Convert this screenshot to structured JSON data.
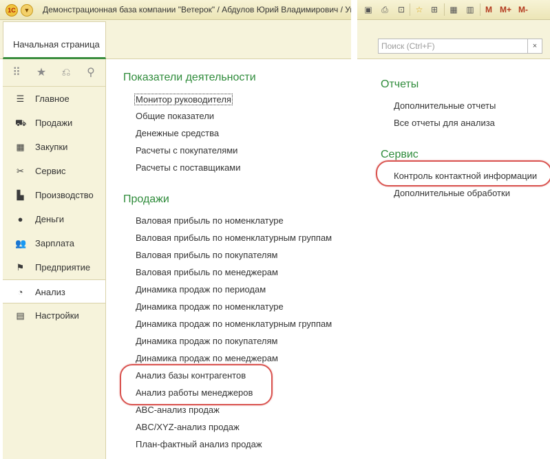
{
  "window": {
    "title": "Демонстрационная база компании \"Ветерок\" / Абдулов Юрий Владимирович / Управл",
    "logo_text": "1С",
    "menu_icon": "chevron-down-icon"
  },
  "home_tab": {
    "label": "Начальная страница"
  },
  "sidebar": {
    "tools": [
      "apps-grid-icon",
      "star-icon",
      "history-icon",
      "search-icon"
    ],
    "items": [
      {
        "label": "Главное",
        "icon": "menu-lines-icon"
      },
      {
        "label": "Продажи",
        "icon": "basket-icon"
      },
      {
        "label": "Закупки",
        "icon": "cart-icon"
      },
      {
        "label": "Сервис",
        "icon": "tools-icon"
      },
      {
        "label": "Производство",
        "icon": "factory-icon"
      },
      {
        "label": "Деньги",
        "icon": "ruble-coin-icon"
      },
      {
        "label": "Зарплата",
        "icon": "people-icon"
      },
      {
        "label": "Предприятие",
        "icon": "flag-icon"
      },
      {
        "label": "Анализ",
        "icon": "pie-chart-icon",
        "active": true
      },
      {
        "label": "Настройки",
        "icon": "settings-list-icon"
      }
    ]
  },
  "content": {
    "sections": [
      {
        "title": "Показатели деятельности",
        "links": [
          "Монитор руководителя",
          "Общие показатели",
          "Денежные средства",
          "Расчеты с покупателями",
          "Расчеты с поставщиками"
        ]
      },
      {
        "title": "Продажи",
        "links": [
          "Валовая прибыль по номенклатуре",
          "Валовая прибыль по номенклатурным группам",
          "Валовая прибыль по покупателям",
          "Валовая прибыль по менеджерам",
          "Динамика продаж по периодам",
          "Динамика продаж по номенклатуре",
          "Динамика продаж по номенклатурным группам",
          "Динамика продаж по покупателям",
          "Динамика продаж по менеджерам",
          "Анализ базы контрагентов",
          "Анализ работы менеджеров",
          "ABC-анализ продаж",
          "ABC/XYZ-анализ продаж",
          "План-фактный анализ продаж"
        ]
      }
    ]
  },
  "right_panel": {
    "toolbar": {
      "icons": [
        "save-icon",
        "print-icon",
        "preview-icon",
        "add-favorite-icon",
        "link-icon",
        "calculator-icon",
        "calendar-icon"
      ],
      "memory": [
        "M",
        "M+",
        "M-"
      ]
    },
    "search": {
      "placeholder": "Поиск (Ctrl+F)",
      "clear_label": "×"
    },
    "sections": [
      {
        "title": "Отчеты",
        "links": [
          "Дополнительные отчеты",
          "Все отчеты для анализа"
        ]
      },
      {
        "title": "Сервис",
        "links": [
          "Контроль контактной информации",
          "Дополнительные обработки"
        ]
      }
    ]
  },
  "colors": {
    "accent_green": "#2e8b3a",
    "panel_bg": "#f6f3db",
    "highlight_red": "#d9534f"
  }
}
